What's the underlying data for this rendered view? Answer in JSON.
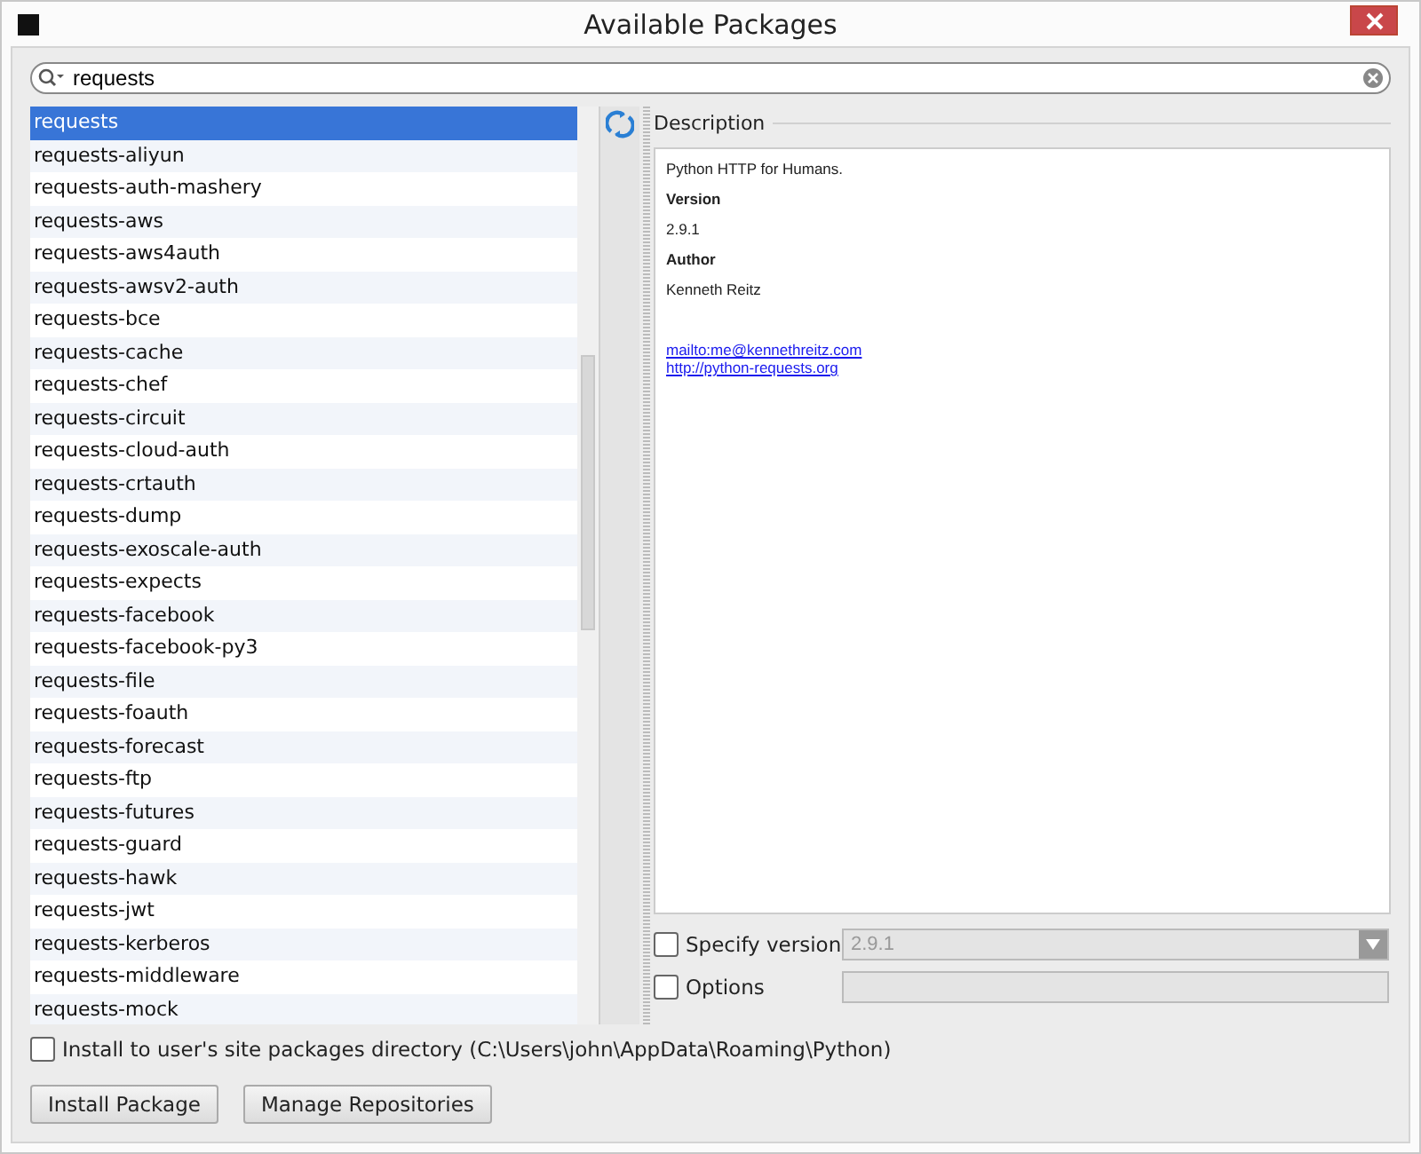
{
  "window": {
    "title": "Available Packages"
  },
  "search": {
    "value": "requests"
  },
  "packages": [
    {
      "name": "requests",
      "selected": true
    },
    {
      "name": "requests-aliyun",
      "selected": false
    },
    {
      "name": "requests-auth-mashery",
      "selected": false
    },
    {
      "name": "requests-aws",
      "selected": false
    },
    {
      "name": "requests-aws4auth",
      "selected": false
    },
    {
      "name": "requests-awsv2-auth",
      "selected": false
    },
    {
      "name": "requests-bce",
      "selected": false
    },
    {
      "name": "requests-cache",
      "selected": false
    },
    {
      "name": "requests-chef",
      "selected": false
    },
    {
      "name": "requests-circuit",
      "selected": false
    },
    {
      "name": "requests-cloud-auth",
      "selected": false
    },
    {
      "name": "requests-crtauth",
      "selected": false
    },
    {
      "name": "requests-dump",
      "selected": false
    },
    {
      "name": "requests-exoscale-auth",
      "selected": false
    },
    {
      "name": "requests-expects",
      "selected": false
    },
    {
      "name": "requests-facebook",
      "selected": false
    },
    {
      "name": "requests-facebook-py3",
      "selected": false
    },
    {
      "name": "requests-file",
      "selected": false
    },
    {
      "name": "requests-foauth",
      "selected": false
    },
    {
      "name": "requests-forecast",
      "selected": false
    },
    {
      "name": "requests-ftp",
      "selected": false
    },
    {
      "name": "requests-futures",
      "selected": false
    },
    {
      "name": "requests-guard",
      "selected": false
    },
    {
      "name": "requests-hawk",
      "selected": false
    },
    {
      "name": "requests-jwt",
      "selected": false
    },
    {
      "name": "requests-kerberos",
      "selected": false
    },
    {
      "name": "requests-middleware",
      "selected": false
    },
    {
      "name": "requests-mock",
      "selected": false
    }
  ],
  "description": {
    "heading": "Description",
    "summary": "Python HTTP for Humans.",
    "version_label": "Version",
    "version": "2.9.1",
    "author_label": "Author",
    "author": "Kenneth Reitz",
    "links": [
      "mailto:me@kennethreitz.com",
      "http://python-requests.org"
    ]
  },
  "specify_version": {
    "label": "Specify version",
    "checked": false,
    "value": "2.9.1"
  },
  "options": {
    "label": "Options",
    "checked": false
  },
  "install_to_user": {
    "label": "Install to user's site packages directory (C:\\Users\\john\\AppData\\Roaming\\Python)",
    "checked": false
  },
  "buttons": [
    "Install Package",
    "Manage Repositories"
  ]
}
